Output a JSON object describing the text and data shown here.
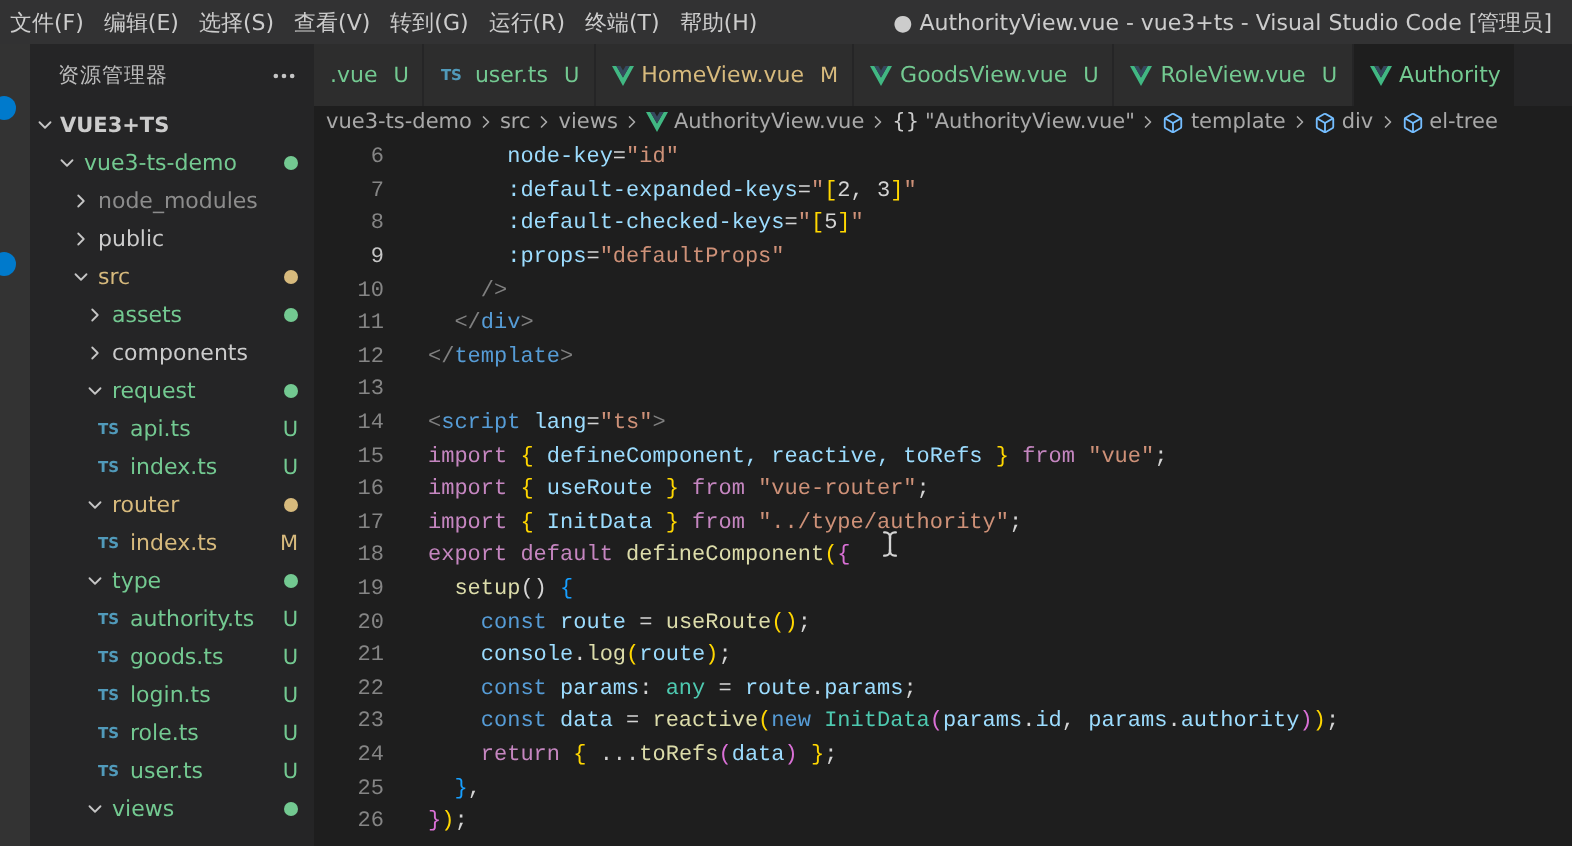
{
  "menu": [
    "文件(F)",
    "编辑(E)",
    "选择(S)",
    "查看(V)",
    "转到(G)",
    "运行(R)",
    "终端(T)",
    "帮助(H)"
  ],
  "window": {
    "title": "● AuthorityView.vue - vue3+ts - Visual Studio Code [管理员]"
  },
  "sidebar": {
    "title": "资源管理器",
    "section": "VUE3+TS",
    "tree": [
      {
        "label": "vue3-ts-demo",
        "kind": "folder",
        "expanded": true,
        "dot": true,
        "color": "#73c991",
        "children": [
          {
            "label": "node_modules",
            "kind": "folder",
            "expanded": false,
            "dot": false,
            "color": "#8c8c8c"
          },
          {
            "label": "public",
            "kind": "folder",
            "expanded": false,
            "dot": false
          },
          {
            "label": "src",
            "kind": "folder",
            "expanded": true,
            "dot": true,
            "color": "#d7ba7d",
            "children": [
              {
                "label": "assets",
                "kind": "folder",
                "expanded": false,
                "dot": true,
                "color": "#73c991"
              },
              {
                "label": "components",
                "kind": "folder",
                "expanded": false,
                "dot": false
              },
              {
                "label": "request",
                "kind": "folder",
                "expanded": true,
                "dot": true,
                "color": "#73c991",
                "children": [
                  {
                    "label": "api.ts",
                    "kind": "ts",
                    "glyph": "TS",
                    "badge": "U",
                    "color": "#73c991"
                  },
                  {
                    "label": "index.ts",
                    "kind": "ts",
                    "glyph": "TS",
                    "badge": "U",
                    "color": "#73c991"
                  }
                ]
              },
              {
                "label": "router",
                "kind": "folder",
                "expanded": true,
                "dot": true,
                "color": "#d7ba7d",
                "children": [
                  {
                    "label": "index.ts",
                    "kind": "ts",
                    "glyph": "TS",
                    "badge": "M",
                    "color": "#d7ba7d"
                  }
                ]
              },
              {
                "label": "type",
                "kind": "folder",
                "expanded": true,
                "dot": true,
                "color": "#73c991",
                "children": [
                  {
                    "label": "authority.ts",
                    "kind": "ts",
                    "glyph": "TS",
                    "badge": "U",
                    "color": "#73c991"
                  },
                  {
                    "label": "goods.ts",
                    "kind": "ts",
                    "glyph": "TS",
                    "badge": "U",
                    "color": "#73c991"
                  },
                  {
                    "label": "login.ts",
                    "kind": "ts",
                    "glyph": "TS",
                    "badge": "U",
                    "color": "#73c991"
                  },
                  {
                    "label": "role.ts",
                    "kind": "ts",
                    "glyph": "TS",
                    "badge": "U",
                    "color": "#73c991"
                  },
                  {
                    "label": "user.ts",
                    "kind": "ts",
                    "glyph": "TS",
                    "badge": "U",
                    "color": "#73c991"
                  }
                ]
              },
              {
                "label": "views",
                "kind": "folder",
                "expanded": true,
                "dot": true,
                "color": "#73c991"
              }
            ]
          }
        ]
      }
    ]
  },
  "tabs": [
    {
      "label": ".vue",
      "badge": "U",
      "kind": "plain",
      "color": "#73c991",
      "selected": false
    },
    {
      "label": "user.ts",
      "badge": "U",
      "kind": "ts",
      "glyph": "TS",
      "color": "#73c991",
      "selected": false
    },
    {
      "label": "HomeView.vue",
      "badge": "M",
      "kind": "vue",
      "color": "#d7ba7d",
      "selected": false
    },
    {
      "label": "GoodsView.vue",
      "badge": "U",
      "kind": "vue",
      "color": "#73c991",
      "selected": false
    },
    {
      "label": "RoleView.vue",
      "badge": "U",
      "kind": "vue",
      "color": "#73c991",
      "selected": false
    },
    {
      "label": "Authority",
      "kind": "vue",
      "color": "#73c991",
      "selected": true
    }
  ],
  "breadcrumb": [
    {
      "label": "vue3-ts-demo",
      "kind": "folder"
    },
    {
      "label": "src",
      "kind": "folder"
    },
    {
      "label": "views",
      "kind": "folder"
    },
    {
      "label": "AuthorityView.vue",
      "kind": "vue"
    },
    {
      "label": "\"AuthorityView.vue\"",
      "kind": "module",
      "glyph": "{}"
    },
    {
      "label": "template",
      "kind": "element"
    },
    {
      "label": "div",
      "kind": "element"
    },
    {
      "label": "el-tree",
      "kind": "element"
    }
  ],
  "code": [
    {
      "number": "6",
      "current": false,
      "tokens": [
        {
          "text": "      node-key",
          "kind": "attr"
        },
        {
          "text": "=",
          "kind": "punct"
        },
        {
          "text": "\"id\"",
          "kind": "string"
        }
      ]
    },
    {
      "number": "7",
      "current": false,
      "tokens": [
        {
          "text": "      :default-expanded-keys",
          "kind": "attr"
        },
        {
          "text": "=",
          "kind": "punct"
        },
        {
          "text": "\"",
          "kind": "string"
        },
        {
          "text": "[",
          "kind": "br1"
        },
        {
          "text": "2, 3",
          "kind": "punct"
        },
        {
          "text": "]",
          "kind": "br1"
        },
        {
          "text": "\"",
          "kind": "string"
        }
      ]
    },
    {
      "number": "8",
      "current": false,
      "tokens": [
        {
          "text": "      :default-checked-keys",
          "kind": "attr"
        },
        {
          "text": "=",
          "kind": "punct"
        },
        {
          "text": "\"",
          "kind": "string"
        },
        {
          "text": "[",
          "kind": "br1"
        },
        {
          "text": "5",
          "kind": "punct"
        },
        {
          "text": "]",
          "kind": "br1"
        },
        {
          "text": "\"",
          "kind": "string"
        }
      ]
    },
    {
      "number": "9",
      "current": true,
      "tokens": [
        {
          "text": "      :props",
          "kind": "attr"
        },
        {
          "text": "=",
          "kind": "punct"
        },
        {
          "text": "\"defaultProps\"",
          "kind": "string"
        }
      ]
    },
    {
      "number": "10",
      "current": false,
      "tokens": [
        {
          "text": "    />",
          "kind": "tagpunct"
        }
      ]
    },
    {
      "number": "11",
      "current": false,
      "tokens": [
        {
          "text": "  </",
          "kind": "tagpunct"
        },
        {
          "text": "div",
          "kind": "tag"
        },
        {
          "text": ">",
          "kind": "tagpunct"
        }
      ]
    },
    {
      "number": "12",
      "current": false,
      "tokens": [
        {
          "text": "</",
          "kind": "tagpunct"
        },
        {
          "text": "template",
          "kind": "tag"
        },
        {
          "text": ">",
          "kind": "tagpunct"
        }
      ]
    },
    {
      "number": "13",
      "current": false
    },
    {
      "number": "14",
      "current": false,
      "tokens": [
        {
          "text": "<",
          "kind": "tagpunct"
        },
        {
          "text": "script",
          "kind": "tag"
        },
        {
          "text": " lang",
          "kind": "attr"
        },
        {
          "text": "=",
          "kind": "punct"
        },
        {
          "text": "\"ts\"",
          "kind": "string"
        },
        {
          "text": ">",
          "kind": "tagpunct"
        }
      ]
    },
    {
      "number": "15",
      "current": false,
      "tokens": [
        {
          "text": "import ",
          "kind": "kw"
        },
        {
          "text": "{",
          "kind": "br1"
        },
        {
          "text": " defineComponent, reactive, toRefs ",
          "kind": "var"
        },
        {
          "text": "}",
          "kind": "br1"
        },
        {
          "text": " from ",
          "kind": "kw"
        },
        {
          "text": "\"vue\"",
          "kind": "string"
        },
        {
          "text": ";",
          "kind": "punct"
        }
      ]
    },
    {
      "number": "16",
      "current": false,
      "tokens": [
        {
          "text": "import ",
          "kind": "kw"
        },
        {
          "text": "{",
          "kind": "br1"
        },
        {
          "text": " useRoute ",
          "kind": "var"
        },
        {
          "text": "}",
          "kind": "br1"
        },
        {
          "text": " from ",
          "kind": "kw"
        },
        {
          "text": "\"vue-router\"",
          "kind": "string"
        },
        {
          "text": ";",
          "kind": "punct"
        }
      ]
    },
    {
      "number": "17",
      "current": false,
      "tokens": [
        {
          "text": "import ",
          "kind": "kw"
        },
        {
          "text": "{",
          "kind": "br1"
        },
        {
          "text": " InitData ",
          "kind": "var"
        },
        {
          "text": "}",
          "kind": "br1"
        },
        {
          "text": " from ",
          "kind": "kw"
        },
        {
          "text": "\"../type/authority\"",
          "kind": "string"
        },
        {
          "text": ";",
          "kind": "punct"
        }
      ]
    },
    {
      "number": "18",
      "current": false,
      "tokens": [
        {
          "text": "export default ",
          "kind": "kw"
        },
        {
          "text": "defineComponent",
          "kind": "fn"
        },
        {
          "text": "(",
          "kind": "br1"
        },
        {
          "text": "{",
          "kind": "br2"
        }
      ]
    },
    {
      "number": "19",
      "current": false,
      "tokens": [
        {
          "text": "  setup",
          "kind": "fn"
        },
        {
          "text": "() ",
          "kind": "punct"
        },
        {
          "text": "{",
          "kind": "br3"
        }
      ]
    },
    {
      "number": "20",
      "current": false,
      "tokens": [
        {
          "text": "    const ",
          "kind": "storage"
        },
        {
          "text": "route",
          "kind": "var"
        },
        {
          "text": " = ",
          "kind": "punct"
        },
        {
          "text": "useRoute",
          "kind": "fn"
        },
        {
          "text": "()",
          "kind": "br1"
        },
        {
          "text": ";",
          "kind": "punct"
        }
      ]
    },
    {
      "number": "21",
      "current": false,
      "tokens": [
        {
          "text": "    console",
          "kind": "var"
        },
        {
          "text": ".",
          "kind": "punct"
        },
        {
          "text": "log",
          "kind": "fn"
        },
        {
          "text": "(",
          "kind": "br1"
        },
        {
          "text": "route",
          "kind": "var"
        },
        {
          "text": ")",
          "kind": "br1"
        },
        {
          "text": ";",
          "kind": "punct"
        }
      ]
    },
    {
      "number": "22",
      "current": false,
      "tokens": [
        {
          "text": "    const ",
          "kind": "storage"
        },
        {
          "text": "params",
          "kind": "var"
        },
        {
          "text": ": ",
          "kind": "punct"
        },
        {
          "text": "any",
          "kind": "type"
        },
        {
          "text": " = ",
          "kind": "punct"
        },
        {
          "text": "route",
          "kind": "var"
        },
        {
          "text": ".",
          "kind": "punct"
        },
        {
          "text": "params",
          "kind": "var"
        },
        {
          "text": ";",
          "kind": "punct"
        }
      ]
    },
    {
      "number": "23",
      "current": false,
      "tokens": [
        {
          "text": "    const ",
          "kind": "storage"
        },
        {
          "text": "data",
          "kind": "var"
        },
        {
          "text": " = ",
          "kind": "punct"
        },
        {
          "text": "reactive",
          "kind": "fn"
        },
        {
          "text": "(",
          "kind": "br1"
        },
        {
          "text": "new ",
          "kind": "storage"
        },
        {
          "text": "InitData",
          "kind": "type"
        },
        {
          "text": "(",
          "kind": "br2"
        },
        {
          "text": "params",
          "kind": "var"
        },
        {
          "text": ".",
          "kind": "punct"
        },
        {
          "text": "id",
          "kind": "var"
        },
        {
          "text": ", ",
          "kind": "punct"
        },
        {
          "text": "params",
          "kind": "var"
        },
        {
          "text": ".",
          "kind": "punct"
        },
        {
          "text": "authority",
          "kind": "var"
        },
        {
          "text": ")",
          "kind": "br2"
        },
        {
          "text": ")",
          "kind": "br1"
        },
        {
          "text": ";",
          "kind": "punct"
        }
      ]
    },
    {
      "number": "24",
      "current": false,
      "tokens": [
        {
          "text": "    return ",
          "kind": "kw"
        },
        {
          "text": "{",
          "kind": "br1"
        },
        {
          "text": " ...",
          "kind": "punct"
        },
        {
          "text": "toRefs",
          "kind": "fn"
        },
        {
          "text": "(",
          "kind": "br2"
        },
        {
          "text": "data",
          "kind": "var"
        },
        {
          "text": ")",
          "kind": "br2"
        },
        {
          "text": " }",
          "kind": "br1"
        },
        {
          "text": ";",
          "kind": "punct"
        }
      ]
    },
    {
      "number": "25",
      "current": false,
      "tokens": [
        {
          "text": "  }",
          "kind": "br3"
        },
        {
          "text": ",",
          "kind": "punct"
        }
      ]
    },
    {
      "number": "26",
      "current": false,
      "tokens": [
        {
          "text": "}",
          "kind": "br2"
        },
        {
          "text": ")",
          "kind": "br1"
        },
        {
          "text": ";",
          "kind": "punct"
        }
      ]
    }
  ]
}
